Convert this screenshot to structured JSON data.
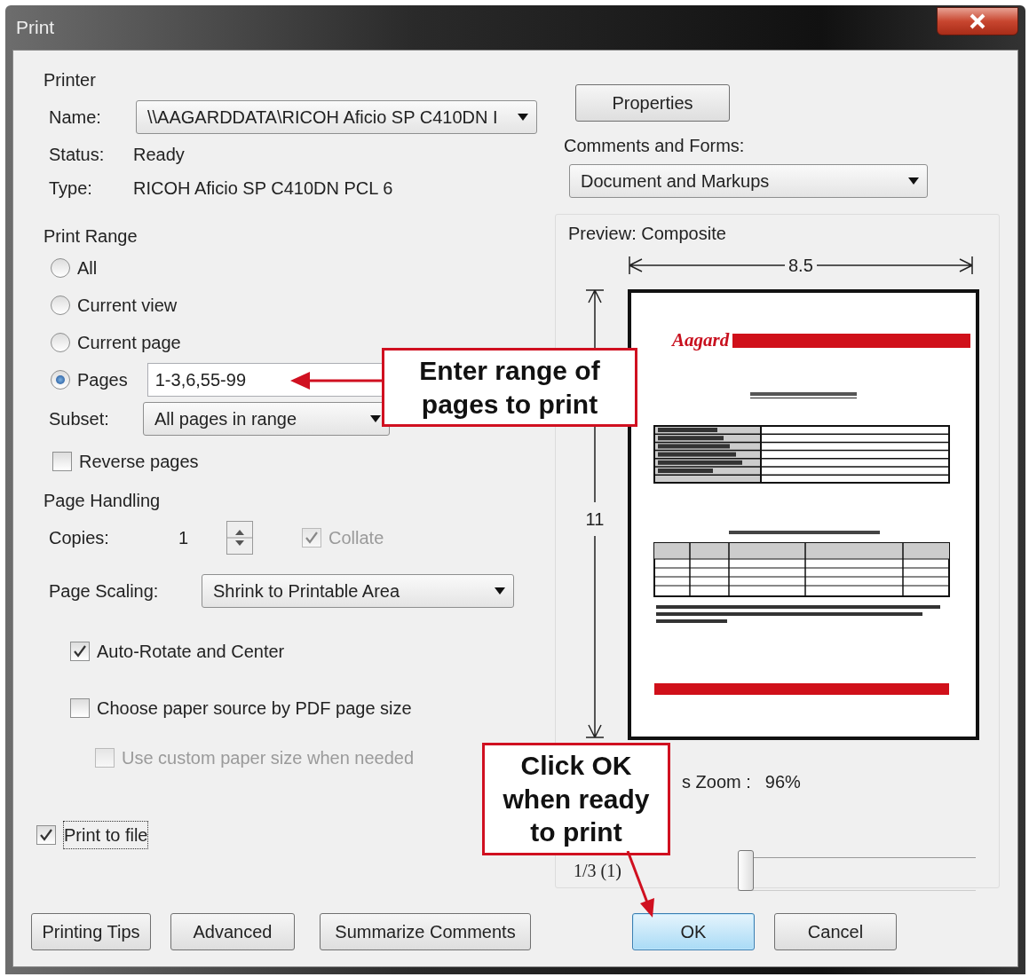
{
  "window": {
    "title": "Print"
  },
  "printer": {
    "heading": "Printer",
    "name_label": "Name:",
    "name_value": "\\\\AAGARDDATA\\RICOH Aficio SP C410DN I",
    "status_label": "Status:",
    "status_value": "Ready",
    "type_label": "Type:",
    "type_value": "RICOH Aficio SP C410DN PCL 6"
  },
  "properties_button": "Properties",
  "print_range": {
    "heading": "Print Range",
    "options": [
      {
        "label": "All",
        "selected": false
      },
      {
        "label": "Current view",
        "selected": false
      },
      {
        "label": "Current page",
        "selected": false
      },
      {
        "label": "Pages",
        "selected": true
      }
    ],
    "pages_value": "1-3,6,55-99",
    "subset_label": "Subset:",
    "subset_value": "All pages in range",
    "reverse": {
      "label": "Reverse pages",
      "checked": false
    }
  },
  "page_handling": {
    "heading": "Page Handling",
    "copies_label": "Copies:",
    "copies_value": "1",
    "collate": {
      "label": "Collate",
      "checked": true,
      "disabled": true
    },
    "scaling_label": "Page Scaling:",
    "scaling_value": "Shrink to Printable Area",
    "options": [
      {
        "label": "Auto-Rotate and Center",
        "checked": true,
        "disabled": false
      },
      {
        "label": "Choose paper source by PDF page size",
        "checked": false,
        "disabled": false
      },
      {
        "label": "Use custom paper size when needed",
        "checked": false,
        "disabled": true
      }
    ]
  },
  "print_to_file": {
    "label": "Print to file",
    "checked": true
  },
  "comments_forms": {
    "label": "Comments and Forms:",
    "value": "Document and Markups"
  },
  "preview": {
    "heading": "Preview: Composite",
    "width_label": "8.5",
    "height_label": "11",
    "page_logo": "Aagard",
    "zoom_label": "s Zoom :",
    "zoom_value": "96%",
    "page_counter": "1/3 (1)",
    "level": 0
  },
  "buttons": [
    {
      "label": "Printing Tips",
      "default": false
    },
    {
      "label": "Advanced",
      "default": false
    },
    {
      "label": "Summarize Comments",
      "default": false
    },
    {
      "label": "OK",
      "default": true
    },
    {
      "label": "Cancel",
      "default": false
    }
  ],
  "callouts": [
    {
      "text": "Enter range of pages to print"
    },
    {
      "text": "Click OK when ready to print"
    }
  ]
}
